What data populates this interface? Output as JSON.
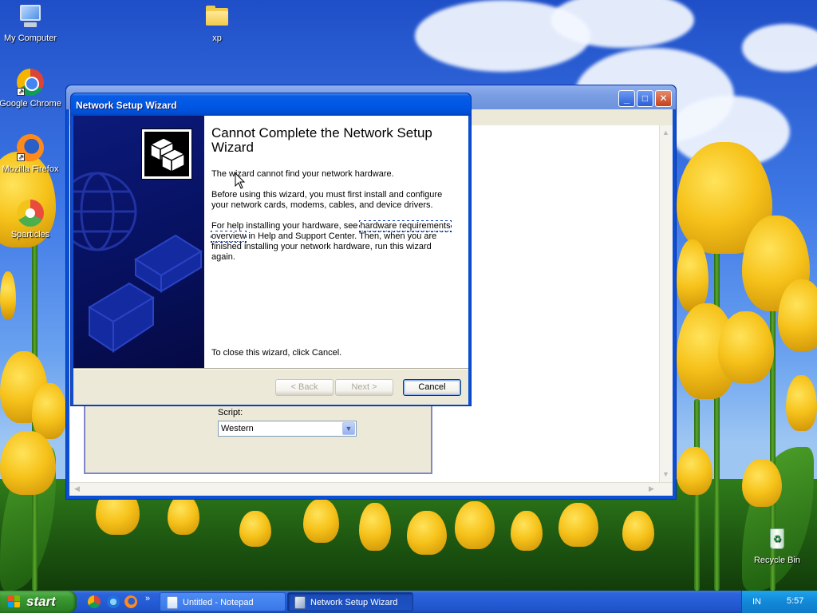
{
  "desktop": {
    "icons": [
      {
        "label": "My Computer",
        "icon": "computer-icon"
      },
      {
        "label": "xp",
        "icon": "folder-icon"
      },
      {
        "label": "Google Chrome",
        "icon": "chrome-icon"
      },
      {
        "label": "Mozilla Firefox",
        "icon": "firefox-icon"
      },
      {
        "label": "Sparticles",
        "icon": "sparticles-icon"
      },
      {
        "label": "Recycle Bin",
        "icon": "recycle-bin-icon"
      }
    ]
  },
  "notepad": {
    "controls": {
      "minimize": "_",
      "maximize": "□",
      "close": "✕"
    },
    "font_dialog": {
      "script_label": "Script:",
      "script_value": "Western"
    }
  },
  "wizard": {
    "title": "Network Setup Wizard",
    "heading": "Cannot Complete the Network Setup Wizard",
    "para1": "The wizard cannot find your network hardware.",
    "para2": "Before using this wizard, you must first install and configure your network cards, modems, cables, and device drivers.",
    "para3_before": "For help installing your hardware, see ",
    "para3_link": "hardware requirements overview",
    "para3_after": " in Help and Support Center. Then, when you are finished installing your network hardware, run this wizard again.",
    "para4": "To close this wizard, click Cancel.",
    "buttons": {
      "back": "< Back",
      "next": "Next >",
      "cancel": "Cancel"
    }
  },
  "taskbar": {
    "start_label": "start",
    "quick_launch": [
      "chrome-icon",
      "ie-icon",
      "firefox-icon"
    ],
    "quick_launch_more": "»",
    "tasks": [
      {
        "label": "Untitled - Notepad",
        "active": false
      },
      {
        "label": "Network Setup Wizard",
        "active": true
      }
    ],
    "tray": {
      "language": "IN",
      "clock": "5:57"
    }
  },
  "colors": {
    "xp_blue": "#0a4fd4",
    "start_green": "#3c9b33",
    "dialog_face": "#ece9d8"
  }
}
